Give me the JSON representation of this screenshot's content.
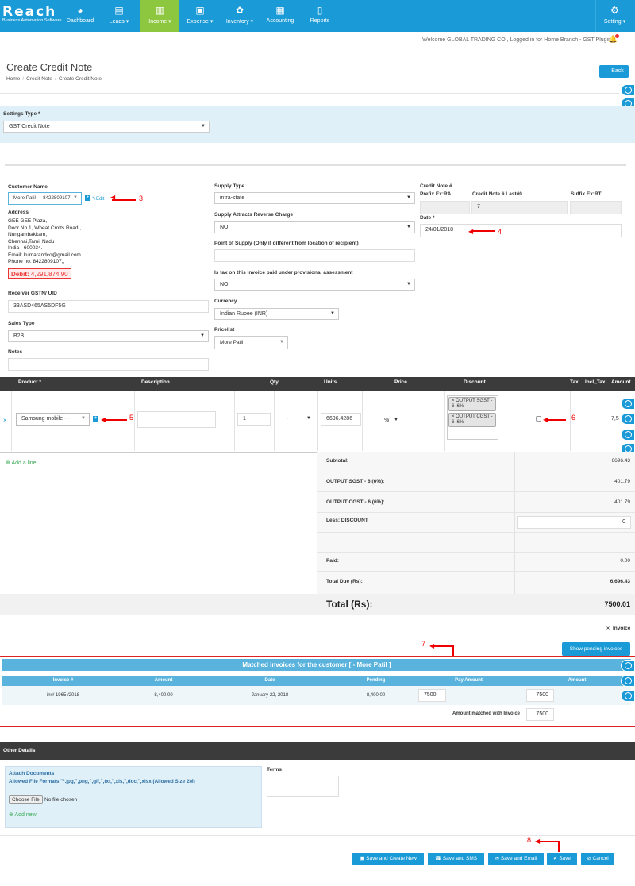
{
  "logo": {
    "main": "Reach",
    "sub": "Business Automation Software"
  },
  "nav": {
    "items": [
      {
        "label": "Dashboard",
        "icon": "dashboard-icon"
      },
      {
        "label": "Leads ▾",
        "icon": "leads-icon"
      },
      {
        "label": "Income ▾",
        "icon": "income-icon"
      },
      {
        "label": "Expense ▾",
        "icon": "expense-icon"
      },
      {
        "label": "Inventory ▾",
        "icon": "inventory-icon"
      },
      {
        "label": "Accounting",
        "icon": "accounting-icon"
      },
      {
        "label": "Reports",
        "icon": "reports-icon"
      }
    ],
    "setting": "Setting ▾"
  },
  "welcome": "Welcome GLOBAL TRADING CO., Logged in for Home Branch - GST Plugin",
  "page": {
    "title": "Create Credit Note",
    "breadcrumb": [
      "Home",
      "/",
      "Credit Note",
      "/",
      "Create Credit Note"
    ],
    "back": "Back"
  },
  "settings": {
    "label": "Settings Type *",
    "value": "GST Credit Note"
  },
  "customer": {
    "label": "Customer Name",
    "value": "More Patil - - 8422809107",
    "edit": "Edit",
    "address_label": "Address",
    "address": [
      "GEE GEE Plaza,",
      "Door No.1, Wheat Crofts Road,,",
      "Nungambakkam,",
      "Chennai,Tamil Nadu",
      "India - 600034.",
      "Email: kumarandco@gmail.com",
      "Phone no: 8422809107,,"
    ],
    "debit_label": "Debit:",
    "debit_value": "4,291,874.90",
    "gstn_label": "Receiver GSTN/ UID",
    "gstn_value": "33ASD465AS5DF5G",
    "sales_type_label": "Sales Type",
    "sales_type_value": "B2B",
    "notes_label": "Notes"
  },
  "supply": {
    "type_label": "Supply Type",
    "type_value": "intra-state",
    "reverse_label": "Supply Attracts Reverse Charge",
    "reverse_value": "NO",
    "pos_label": "Point of Supply (Only if different from location of recipient)",
    "provisional_label": "Is tax on this Invoice paid under provisional assessment",
    "provisional_value": "NO",
    "currency_label": "Currency",
    "currency_value": "Indian Rupee (INR)",
    "pricelist_label": "Pricelist",
    "pricelist_value": "More Patil"
  },
  "credit": {
    "label": "Credit Note #",
    "prefix_label": "Prefix Ex:RA",
    "last_label": "Credit Note # Last#0",
    "suffix_label": "Suffix Ex:RT",
    "number": "7",
    "date_label": "Date *",
    "date_value": "24/01/2018"
  },
  "annotations": [
    "3",
    "4",
    "5",
    "6",
    "7",
    "8"
  ],
  "table": {
    "headers": [
      "Product *",
      "Description",
      "Qty",
      "Units",
      "Price",
      "Discount",
      "Tax",
      "Incl_Tax",
      "Amount"
    ],
    "product": "Samsung mobile - -",
    "qty": "1",
    "units": "-",
    "price": "6696.4286",
    "discount_type": "%",
    "taxes": [
      "OUTPUT SGST - 6 :6%",
      "OUTPUT CGST - 6 :6%"
    ],
    "amount": "7,5"
  },
  "add_line": "Add a line",
  "summary": [
    {
      "label": "Subtotal:",
      "value": "6696.43"
    },
    {
      "label": "OUTPUT SGST - 6 (6%):",
      "value": "401.79"
    },
    {
      "label": "OUTPUT CGST - 6 (6%):",
      "value": "401.79"
    },
    {
      "label": "Less: DISCOUNT",
      "value": "0"
    },
    {
      "label": "Paid:",
      "value": "0.00"
    },
    {
      "label": "Total Due (Rs):",
      "value": "6,696.43"
    }
  ],
  "total": {
    "label": "Total (Rs):",
    "value": "7500.01"
  },
  "invoice_radio": "Invoice",
  "show_pending": "Show pending invoices",
  "matched": {
    "title": "Matched invoices for the customer [ - More Patil ]",
    "headers": [
      "Invoice #",
      "Amount",
      "Date",
      "Pending",
      "Pay Amount",
      "Amount"
    ],
    "row": {
      "invoice": "inv/ 1965 /2018",
      "amount": "8,400.00",
      "date": "January 22, 2018",
      "pending": "8,400.00",
      "pay": "7500",
      "amt": "7500"
    },
    "footer_label": "Amount matched with Invoice",
    "footer_value": "7500"
  },
  "other": {
    "title": "Other Details",
    "attach_label": "Attach Documents",
    "formats": "Allowed File Formats \"*.jpg,\",png,\",gif,\",txt,\",xls,\",doc,\",xlsx (Allowed Size 2M)",
    "choose": "Choose File",
    "nofile": "No file chosen",
    "addnew": "Add new",
    "terms_label": "Terms"
  },
  "buttons": {
    "save_new": "Save and Create New",
    "save_sms": "Save and SMS",
    "save_email": "Save and Email",
    "save": "Save",
    "cancel": "Cancel"
  }
}
